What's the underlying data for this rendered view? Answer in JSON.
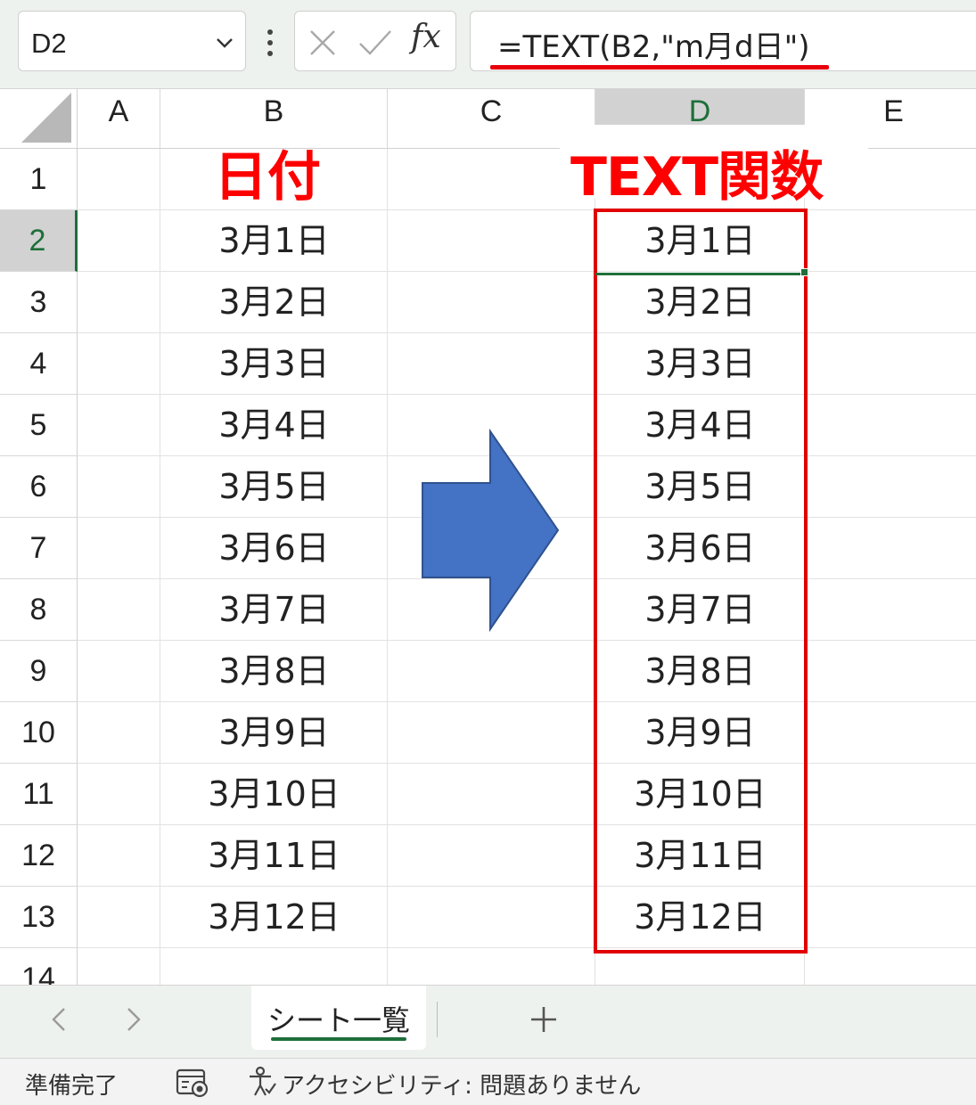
{
  "formula_bar": {
    "name_box": "D2",
    "formula": "=TEXT(B2,\"m月d日\")",
    "cancel_icon": "x-icon",
    "enter_icon": "check-icon",
    "function_icon": "fx"
  },
  "columns": [
    "A",
    "B",
    "C",
    "D",
    "E"
  ],
  "active_column": "D",
  "active_row": "2",
  "rows": [
    "1",
    "2",
    "3",
    "4",
    "5",
    "6",
    "7",
    "8",
    "9",
    "10",
    "11",
    "12",
    "13",
    "14"
  ],
  "annotations": {
    "column_b_label": "日付",
    "column_d_label": "TEXT関数"
  },
  "column_b_values": [
    "3月1日",
    "3月2日",
    "3月3日",
    "3月4日",
    "3月5日",
    "3月6日",
    "3月7日",
    "3月8日",
    "3月9日",
    "3月10日",
    "3月11日",
    "3月12日"
  ],
  "column_d_values": [
    "3月1日",
    "3月2日",
    "3月3日",
    "3月4日",
    "3月5日",
    "3月6日",
    "3月7日",
    "3月8日",
    "3月9日",
    "3月10日",
    "3月11日",
    "3月12日"
  ],
  "sheet_tabs": {
    "active": "シート一覧",
    "add_label": "+"
  },
  "status_bar": {
    "ready": "準備完了",
    "accessibility": "アクセシビリティ: 問題ありません"
  },
  "colors": {
    "accent_green": "#1e6f3a",
    "highlight_red": "#e00000",
    "arrow_blue": "#4472c4"
  }
}
